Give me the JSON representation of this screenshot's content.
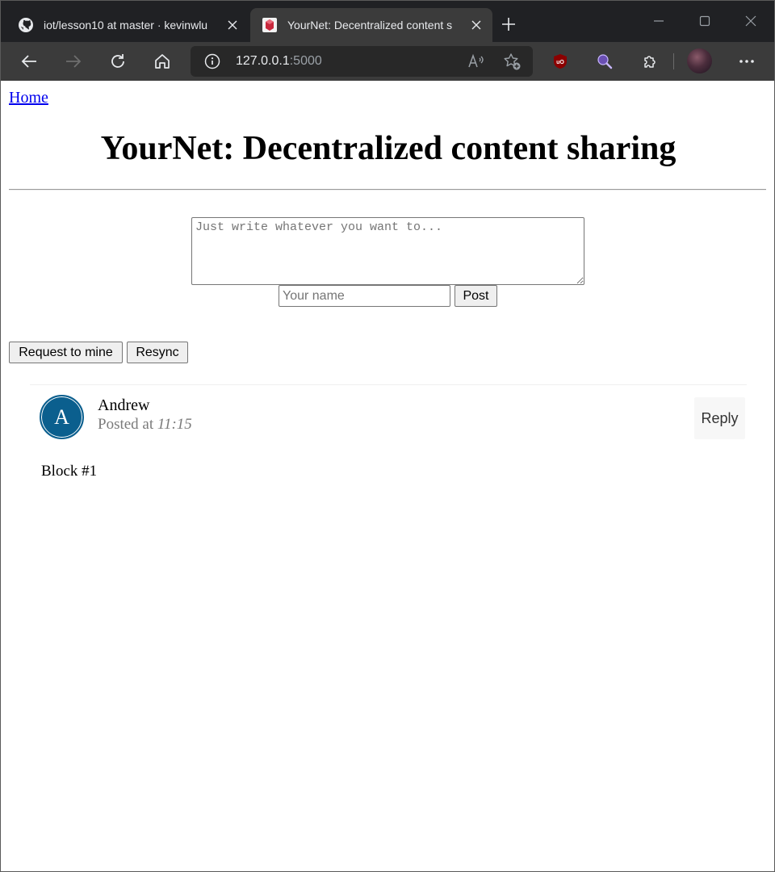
{
  "browser": {
    "tabs": [
      {
        "title": "iot/lesson10 at master · kevinwlu",
        "icon": "github-icon",
        "active": false
      },
      {
        "title": "YourNet: Decentralized content s",
        "icon": "site-favicon-icon",
        "active": true
      }
    ],
    "url_host": "127.0.0.1",
    "url_port": ":5000",
    "colors": {
      "chrome_dark": "#202124",
      "toolbar": "#3b3b3b",
      "ublock_red": "#8b0000"
    }
  },
  "page": {
    "home_link": "Home",
    "title": "YourNet: Decentralized content sharing",
    "form": {
      "content_placeholder": "Just write whatever you want to...",
      "name_placeholder": "Your name",
      "post_button": "Post"
    },
    "request_mine_button": "Request to mine",
    "resync_button": "Resync",
    "posts": [
      {
        "avatar_letter": "A",
        "author": "Andrew",
        "posted_prefix": "Posted at",
        "time": "11:15",
        "reply_button": "Reply",
        "content": "Block #1",
        "avatar_color": "#0b5f8e"
      }
    ]
  }
}
